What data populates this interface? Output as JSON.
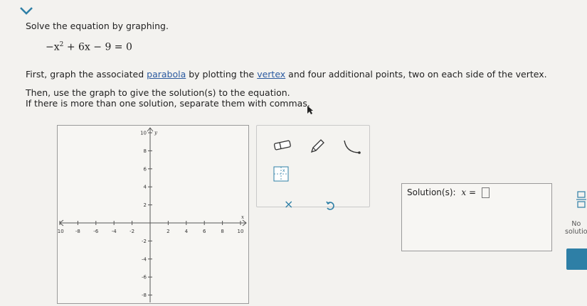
{
  "prompt": "Solve the equation by graphing.",
  "equation": {
    "lead": "−x",
    "exp": "2",
    "rest": " + 6x − 9 = 0"
  },
  "instr1": {
    "a": "First, graph the associated ",
    "parabola": "parabola",
    "b": " by plotting the ",
    "vertex": "vertex",
    "c": " and four additional points, two on each side of the vertex."
  },
  "instr2": "Then, use the graph to give the solution(s) to the equation.",
  "instr3": "If there is more than one solution, separate them with commas.",
  "graph": {
    "x_label": "x",
    "y_label": "y",
    "x_ticks": [
      "-10",
      "-8",
      "-6",
      "-4",
      "-2",
      "2",
      "4",
      "6",
      "8",
      "10"
    ],
    "y_ticks_pos": [
      "10",
      "8",
      "6",
      "4",
      "2"
    ],
    "y_ticks_neg": [
      "-2",
      "-4",
      "-6",
      "-8"
    ]
  },
  "tools": {
    "eraser_icon": "eraser-icon",
    "pencil_icon": "pencil-icon",
    "parabola_icon": "parabola-tool-icon",
    "point_icon": "point-tool-icon",
    "clear": "×",
    "undo_icon": "undo-icon"
  },
  "solution": {
    "label": "Solution(s):",
    "var": "x =",
    "value": ""
  },
  "side": {
    "no_solution_l1": "No",
    "no_solution_l2": "solutio"
  },
  "colors": {
    "accent": "#2e7fa6",
    "link": "#2b5aa0"
  }
}
